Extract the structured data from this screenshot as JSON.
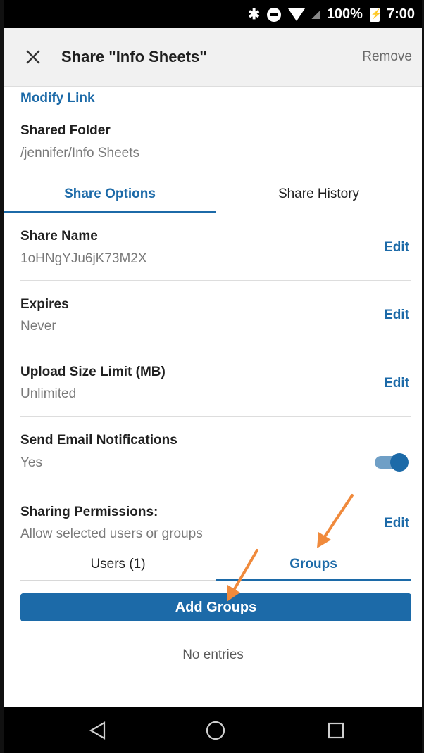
{
  "status_bar": {
    "battery": "100%",
    "time": "7:00"
  },
  "header": {
    "title": "Share \"Info Sheets\"",
    "remove_label": "Remove"
  },
  "modify_link": "Modify Link",
  "shared_folder": {
    "label": "Shared Folder",
    "path": "/jennifer/Info Sheets"
  },
  "tabs": [
    {
      "label": "Share Options",
      "active": true
    },
    {
      "label": "Share History",
      "active": false
    }
  ],
  "settings": [
    {
      "label": "Share Name",
      "value": "1oHNgYJu6jK73M2X",
      "action": "Edit"
    },
    {
      "label": "Expires",
      "value": "Never",
      "action": "Edit"
    },
    {
      "label": "Upload Size Limit (MB)",
      "value": "Unlimited",
      "action": "Edit"
    },
    {
      "label": "Send Email Notifications",
      "value": "Yes",
      "toggle_on": true
    }
  ],
  "permissions": {
    "label": "Sharing Permissions:",
    "value": "Allow selected users or groups",
    "action": "Edit",
    "subtabs": [
      {
        "label": "Users (1)",
        "active": false
      },
      {
        "label": "Groups",
        "active": true
      }
    ],
    "add_button": "Add Groups",
    "empty_text": "No entries"
  },
  "colors": {
    "accent": "#1c6aa8",
    "annotation_arrow": "#f08a3c"
  }
}
